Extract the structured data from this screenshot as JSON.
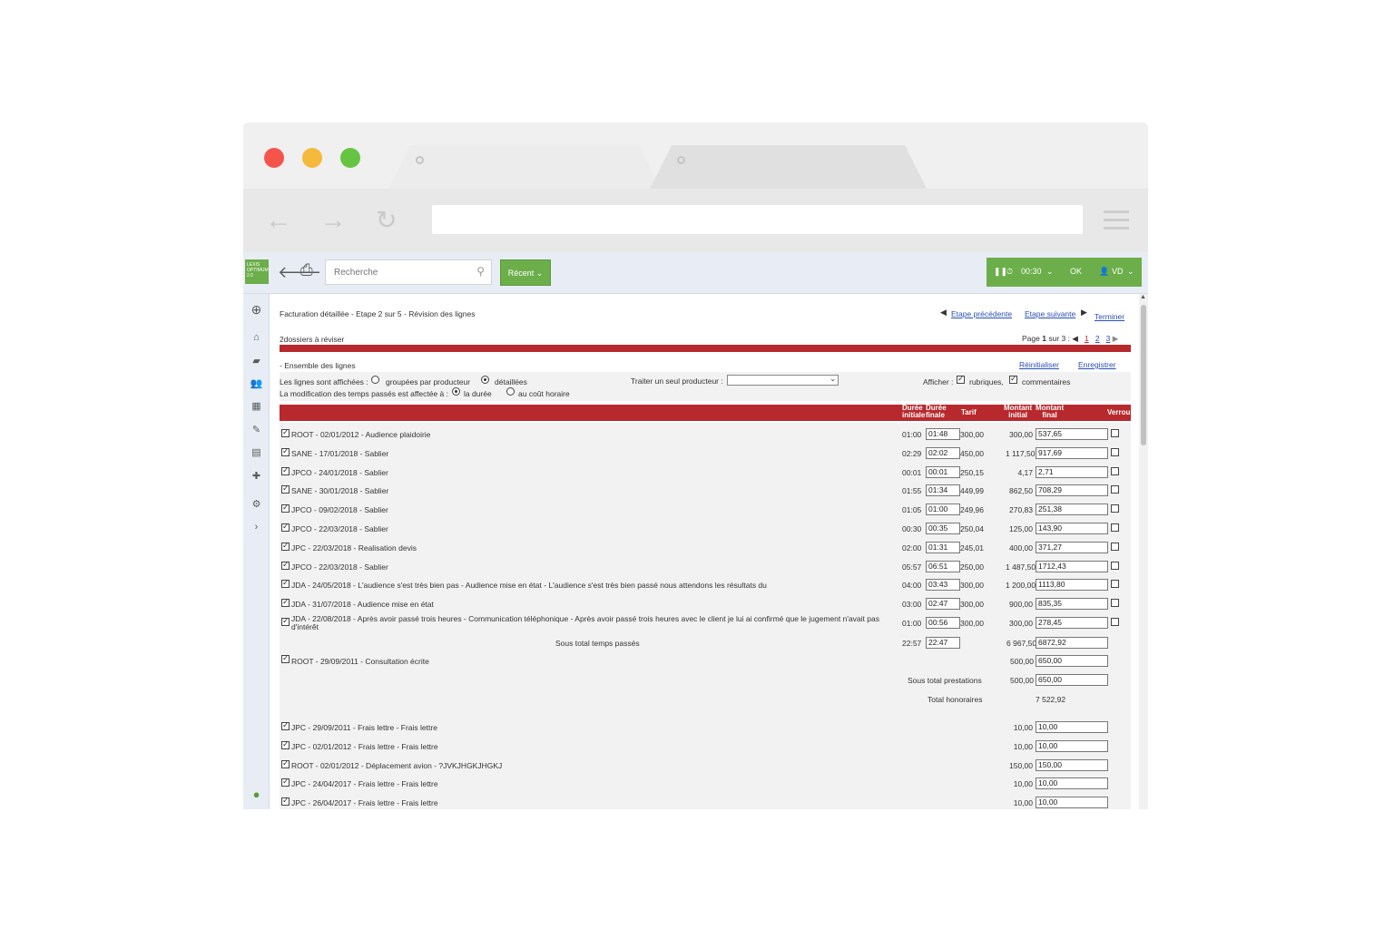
{
  "header": {
    "logo_lines": [
      "LEXIS",
      "OPTIMUM",
      "2.0"
    ],
    "search_placeholder": "Recherche",
    "recent_label": "Récent ⌄",
    "timer": "00:30",
    "ok_label": "OK",
    "user": "VD"
  },
  "page": {
    "title": "Facturation détaillée - Etape 2 sur 5 - Révision des lignes",
    "prev_step": "Etape précédente",
    "next_step": "Etape suivante",
    "finish": "Terminer",
    "dossiers": "2dossiers à réviser",
    "page_label": "Page",
    "page_current": "1",
    "page_of": "sur",
    "page_total": "3 :",
    "pages": [
      "1",
      "2",
      "3"
    ],
    "section_title": "- Ensemble des lignes",
    "reset": "Réinitialiser",
    "save": "Enregistrer",
    "display_label": "Les lignes sont affichées :",
    "opt_grouped": "groupées  par producteur",
    "opt_detailed": "détaillées",
    "single_producer": "Traiter un seul producteur :",
    "afficher": "Afficher :",
    "opt_rubriques": "rubriques,",
    "opt_commentaires": "commentaires",
    "modif_label": "La modification des temps passés est affectée à :",
    "opt_duree": "la durée",
    "opt_cout": "au coût horaire"
  },
  "table": {
    "h_duree_init_1": "Durée",
    "h_duree_init_2": "initiale",
    "h_duree_fin_1": "Durée",
    "h_duree_fin_2": "finale",
    "h_tarif": "Tarif",
    "h_mont_init_1": "Montant",
    "h_mont_init_2": "initial",
    "h_mont_fin_1": "Montant",
    "h_mont_fin_2": "final",
    "h_verrou": "Verrou",
    "rows": [
      {
        "label": "ROOT - 02/01/2012 - Audience plaidoirie",
        "di": "01:00",
        "df": "01:48",
        "tarif": "300,00",
        "mi": "300,00",
        "mf": "537,65"
      },
      {
        "label": "SANE - 17/01/2018 - Sablier",
        "di": "02:29",
        "df": "02:02",
        "tarif": "450,00",
        "mi": "1 117,50",
        "mf": "917,69"
      },
      {
        "label": "JPCO - 24/01/2018 - Sablier",
        "di": "00:01",
        "df": "00:01",
        "tarif": "250,15",
        "mi": "4,17",
        "mf": "2,71"
      },
      {
        "label": "SANE - 30/01/2018 - Sablier",
        "di": "01:55",
        "df": "01:34",
        "tarif": "449,99",
        "mi": "862,50",
        "mf": "708,29"
      },
      {
        "label": "JPCO - 09/02/2018 - Sablier",
        "di": "01:05",
        "df": "01:00",
        "tarif": "249,96",
        "mi": "270,83",
        "mf": "251,38"
      },
      {
        "label": "JPCO - 22/03/2018 - Sablier",
        "di": "00:30",
        "df": "00:35",
        "tarif": "250,04",
        "mi": "125,00",
        "mf": "143,90"
      },
      {
        "label": "JPC - 22/03/2018 - Realisation devis",
        "di": "02:00",
        "df": "01:31",
        "tarif": "245,01",
        "mi": "400,00",
        "mf": "371,27"
      },
      {
        "label": "JPCO - 22/03/2018 - Sablier",
        "di": "05:57",
        "df": "06:51",
        "tarif": "250,00",
        "mi": "1 487,50",
        "mf": "1712,43"
      },
      {
        "label": "JDA - 24/05/2018 - L'audience s'est très bien pas - Audience mise en état - L'audience s'est très bien passé nous attendons les résultats du",
        "di": "04:00",
        "df": "03:43",
        "tarif": "300,00",
        "mi": "1 200,00",
        "mf": "1113,80"
      },
      {
        "label": "JDA - 31/07/2018 - Audience mise en état",
        "di": "03:00",
        "df": "02:47",
        "tarif": "300,00",
        "mi": "900,00",
        "mf": "835,35"
      },
      {
        "label": "JDA - 22/08/2018 - Après avoir passé trois heures - Communication téléphonique - Après avoir passé trois heures avec le client je lui ai confirmé que le jugement n'avait pas",
        "label2": "d'intérêt",
        "di": "01:00",
        "df": "00:56",
        "tarif": "300,00",
        "mi": "300,00",
        "mf": "278,45"
      }
    ],
    "subtotal_time_label": "Sous total temps passés",
    "subtotal_time_di": "22:57",
    "subtotal_time_df": "22:47",
    "subtotal_time_mi": "6 967,50",
    "subtotal_time_mf": "6872,92",
    "presta_row": {
      "label": "ROOT - 29/09/2011 - Consultation écrite",
      "mi": "500,00",
      "mf": "650,00"
    },
    "subtotal_presta_label": "Sous total prestations",
    "subtotal_presta_mi": "500,00",
    "subtotal_presta_mf": "650,00",
    "total_hon_label": "Total honoraires",
    "total_hon_value": "7 522,92",
    "frais": [
      {
        "label": "JPC - 29/09/2011 - Frais lettre - Frais lettre",
        "mi": "10,00",
        "mf": "10,00"
      },
      {
        "label": "JPC - 02/01/2012 - Frais lettre - Frais lettre",
        "mi": "10,00",
        "mf": "10,00"
      },
      {
        "label": "ROOT - 02/01/2012 - Déplacement avion - ?JVKJHGKJHGKJ",
        "mi": "150,00",
        "mf": "150,00"
      },
      {
        "label": "JPC - 24/04/2017 - Frais lettre - Frais lettre",
        "mi": "10,00",
        "mf": "10,00"
      },
      {
        "label": "JPC - 26/04/2017 - Frais lettre - Frais lettre",
        "mi": "10,00",
        "mf": "10,00"
      }
    ]
  },
  "colors": {
    "accent_green": "#6cae4a",
    "table_red": "#b8292e",
    "link_blue": "#2a4fb5"
  }
}
